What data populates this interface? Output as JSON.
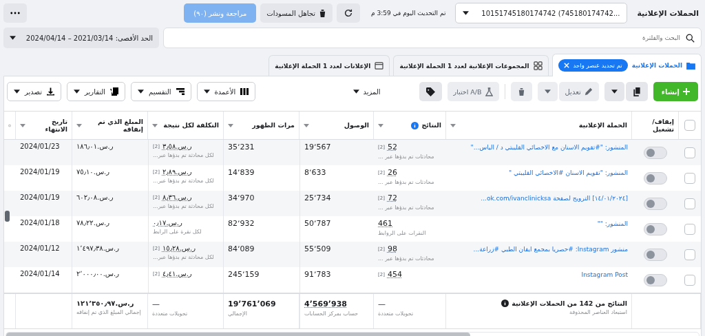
{
  "header": {
    "title": "الحملات الإعلانية",
    "account": "10151745180174742 (745180174742...",
    "updated": "تم التحديث اليوم في 3:59 م",
    "discard_button": "تجاهل المسودات",
    "publish_button": {
      "label": "مراجعة ونشر (٩٠)",
      "disabled": true
    }
  },
  "filter": {
    "search_placeholder": "البحث والفلترة",
    "date_range": "الحد الأقصى: 2021/03/14 – 2024/04/14"
  },
  "tabs": [
    {
      "kind": "campaigns",
      "label": "الحملات الإعلانية",
      "selected": true,
      "chip": "تم تحديد عنصر واحد"
    },
    {
      "kind": "ad_sets",
      "label": "المجموعات الإعلانية لعدد **1** الحملة الإعلانية",
      "selected": false
    },
    {
      "kind": "ads",
      "label": "الإعلانات لعدد **1** الحملة الإعلانية",
      "selected": false
    }
  ],
  "toolbar": {
    "actions": [
      {
        "kind": "create",
        "label": "إنشاء",
        "disabled": false
      },
      {
        "kind": "duplicate",
        "disabled": false
      },
      {
        "kind": "edit",
        "label": "تعديل",
        "disabled": true
      },
      {
        "kind": "delete",
        "disabled": true
      },
      {
        "kind": "ab_test",
        "label": "اختبار A/B",
        "disabled": true
      },
      {
        "kind": "tag",
        "disabled": false
      },
      {
        "kind": "more",
        "label": "المزيد",
        "disabled": false
      }
    ],
    "view_buttons": [
      {
        "kind": "columns",
        "label": "الأعمدة"
      },
      {
        "kind": "breakdown",
        "label": "التقسيم"
      },
      {
        "kind": "reports",
        "label": "التقارير"
      },
      {
        "kind": "export",
        "label": "تصدير"
      }
    ]
  },
  "table": {
    "all_selected": false,
    "columns": [
      "إيقاف/تشغيل",
      "الحملة الإعلانية",
      "النتائج",
      "الوصول",
      "مرات الظهور",
      "التكلفة لكل نتيجة",
      "المبلغ الذي تم إنفاقه",
      "تاريخ الانتهاء"
    ],
    "rows": [
      {
        "selected": false,
        "on": false,
        "name": "المنشور: \"#تقويم الاسنان مع الاخصائي القليبتي د / الياس...\"",
        "results": "52",
        "results_note": "[2]",
        "results_sub": "محادثات تم بدؤها عبر ...",
        "reach": "19٬567",
        "impressions": "35٬231",
        "cost": "ر.س.٣٫٥٨",
        "cost_note": "[2]",
        "cost_sub": "لكل محادثة تم بدؤها عبر...",
        "spent": "ر.س.١٨٦٫٠١",
        "end_date": "2024/01/23"
      },
      {
        "selected": false,
        "on": false,
        "name": "المنشور: \"تقويم الاسنان #الاخصائي القليبتي \"",
        "results": "26",
        "results_note": "[2]",
        "results_sub": "محادثات تم بدؤها عبر ...",
        "reach": "8٬633",
        "impressions": "14٬839",
        "cost": "ر.س.٢٫٨٩",
        "cost_note": "[2]",
        "cost_sub": "لكل محادثة تم بدؤها عبر...",
        "spent": "ر.س.٧٥٫١٠",
        "end_date": "2024/01/19"
      },
      {
        "selected": false,
        "on": false,
        "name": "[١٤/٠١/٢٠٢٤] الترويج لصفحة ok.com/ivanclinicksa...",
        "results": "72",
        "results_note": "[2]",
        "results_sub": "محادثات تم بدؤها عبر ...",
        "reach": "25٬734",
        "impressions": "34٬970",
        "cost": "ر.س.٨٫٣٦",
        "cost_note": "[2]",
        "cost_sub": "لكل محادثة تم بدؤها عبر...",
        "spent": "ر.س.٦٠٢٫٠٨",
        "end_date": "2024/01/19"
      },
      {
        "selected": false,
        "on": false,
        "name": "المنشور: \"\"",
        "results": "461",
        "results_sub": "النقرات على الروابط",
        "reach": "50٬787",
        "impressions": "82٬932",
        "cost": "ر.س.٠٫١٧",
        "cost_sub": "لكل نقرة على الرابط",
        "spent": "ر.س.٧٨٫٢٢",
        "end_date": "2024/01/18"
      },
      {
        "selected": false,
        "on": false,
        "name": "منشور Instagram: #حصريا بمجمع ايفان الطبي #زراعة...",
        "results": "98",
        "results_note": "[2]",
        "results_sub": "محادثات تم بدؤها عبر ...",
        "reach": "55٬509",
        "impressions": "84٬089",
        "cost": "ر.س.١٥٫٢٨",
        "cost_note": "[2]",
        "cost_sub": "لكل محادثة تم بدؤها عبر...",
        "spent": "ر.س.١٬٤٩٧٫٣٨",
        "end_date": "2024/01/12"
      },
      {
        "selected": false,
        "on": false,
        "name": "Instagram Post",
        "results": "454",
        "results_note": "[2]",
        "reach": "91٬783",
        "impressions": "245٬159",
        "cost": "ر.س.٤٫٤١",
        "cost_note": "[2]",
        "spent": "ر.س.٢٬٠٠٠٫٠٠",
        "end_date": "2024/01/14"
      }
    ],
    "totals": {
      "summary": "النتائج من 142 من الحملات الإعلانية",
      "summary_sub": "استبعاد العناصر المحذوفة",
      "results": "—",
      "results_sub": "تحويلات متعددة",
      "reach": "4٬569٬938",
      "reach_sub": "حساب بمركز الحسابات",
      "impressions": "19٬761٬069",
      "impressions_sub": "الإجمالي",
      "cost": "—",
      "cost_sub": "تحويلات متعددة",
      "spent": "ر.س.١٢١٬٣٥٠٫٩٧",
      "spent_sub": "إجمالي المبلغ الذي تم إنفاقه"
    }
  }
}
